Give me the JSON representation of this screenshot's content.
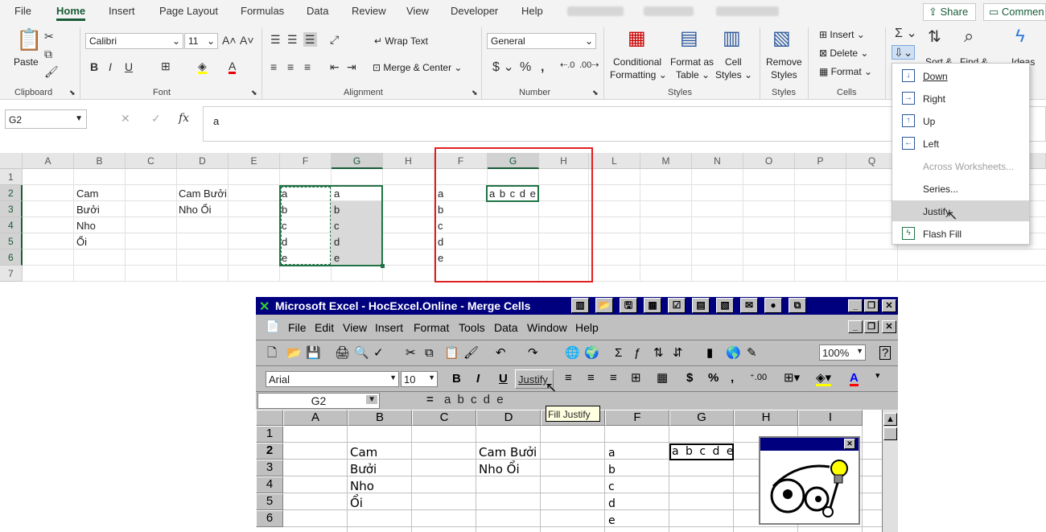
{
  "ribbon": {
    "tabs": [
      "File",
      "Home",
      "Insert",
      "Page Layout",
      "Formulas",
      "Data",
      "Review",
      "View",
      "Developer",
      "Help"
    ],
    "share_label": "Share",
    "comments_label": "Commen",
    "clipboard": {
      "paste": "Paste",
      "group": "Clipboard"
    },
    "font": {
      "name": "Calibri",
      "size": "11",
      "group": "Font"
    },
    "alignment": {
      "wrap": "Wrap Text",
      "merge": "Merge & Center",
      "group": "Alignment"
    },
    "number": {
      "format": "General",
      "group": "Number"
    },
    "styles": {
      "conditional": "Conditional",
      "formatting": "Formatting",
      "format_as": "Format as",
      "table": "Table",
      "cell": "Cell",
      "styles_word": "Styles",
      "group": "Styles"
    },
    "remove_styles": {
      "remove": "Remove",
      "styles_word": "Styles",
      "group": "Styles"
    },
    "cells": {
      "insert": "Insert",
      "delete": "Delete",
      "format": "Format",
      "group": "Cells"
    },
    "editing": {
      "sort": "Sort &",
      "find": "Find &",
      "ideas": "Ideas"
    }
  },
  "formula_bar": {
    "name_box": "G2",
    "fx": "fx",
    "value": "a"
  },
  "grid": {
    "columns": [
      "A",
      "B",
      "C",
      "D",
      "E",
      "F",
      "G",
      "H",
      "F",
      "G",
      "H",
      "L",
      "M",
      "N",
      "O",
      "P",
      "Q"
    ],
    "rows": [
      "1",
      "2",
      "3",
      "4",
      "5",
      "6",
      "7"
    ],
    "cells": {
      "b2": "Cam",
      "b3": "Bưởi",
      "b4": "Nho",
      "b5": "Ổi",
      "d2": "Cam Bưởi",
      "d3": "Nho Ổi",
      "f2": "a",
      "f3": "b",
      "f4": "c",
      "f5": "d",
      "f6": "e",
      "g2": "a",
      "g3": "b",
      "g4": "c",
      "g5": "d",
      "g6": "e",
      "f2b": "a",
      "f3b": "b",
      "f4b": "c",
      "f5b": "d",
      "f6b": "e",
      "g2b": "a b c d e"
    }
  },
  "fill_menu": {
    "items": [
      "Down",
      "Right",
      "Up",
      "Left",
      "Across Worksheets...",
      "Series...",
      "Justify",
      "Flash Fill"
    ]
  },
  "excel97": {
    "title": "Microsoft Excel - HocExcel.Online - Merge Cells",
    "menus": [
      "File",
      "Edit",
      "View",
      "Insert",
      "Format",
      "Tools",
      "Data",
      "Window",
      "Help"
    ],
    "font": "Arial",
    "size": "10",
    "zoom": "100%",
    "justify_label": "Justify",
    "tooltip": "Fill Justify",
    "name_box": "G2",
    "equals": "=",
    "formula": "a b c d e",
    "columns": [
      "A",
      "B",
      "C",
      "D",
      "E",
      "F",
      "G",
      "H",
      "I"
    ],
    "rows": [
      "1",
      "2",
      "3",
      "4",
      "5",
      "6"
    ],
    "cells": {
      "b2": "Cam",
      "b3": "Bưởi",
      "b4": "Nho",
      "b5": "Ổi",
      "d2": "Cam Bưởi",
      "d3": "Nho Ổi",
      "f2": "a",
      "f3": "b",
      "f4": "c",
      "f5": "d",
      "f6": "e",
      "g2": "a b c d e"
    }
  }
}
